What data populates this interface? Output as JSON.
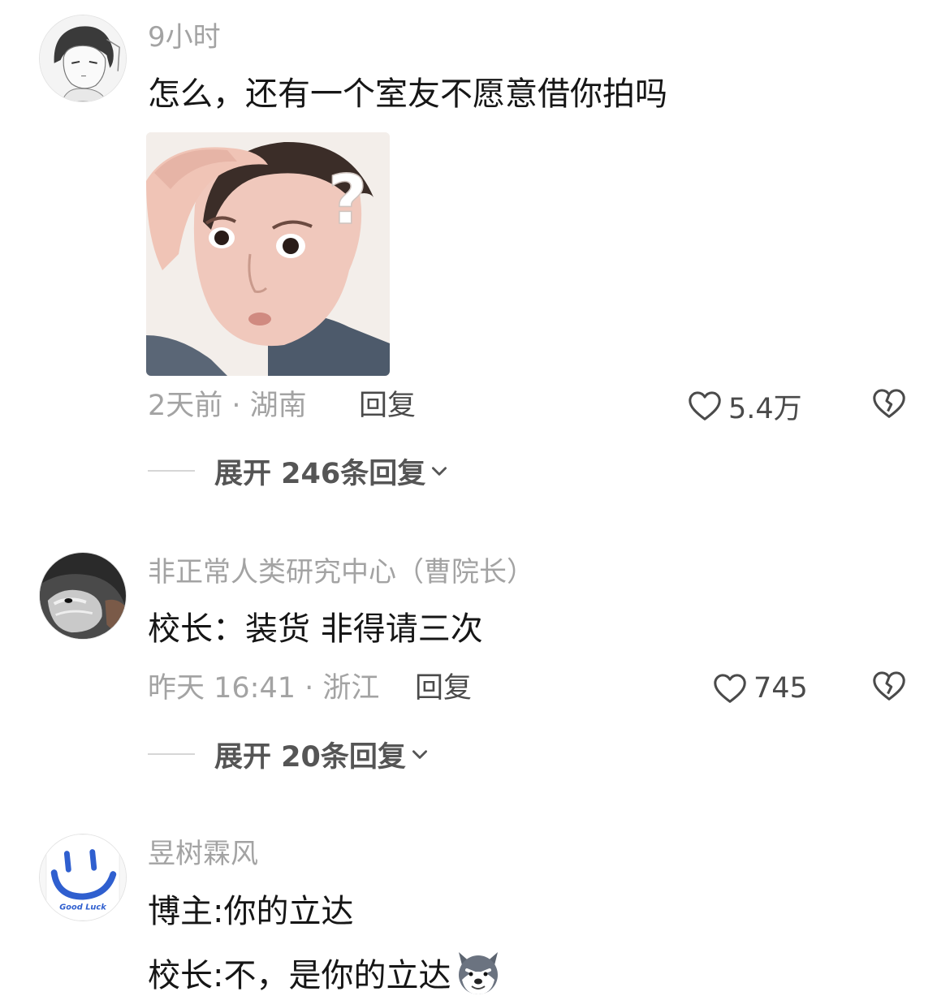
{
  "comments": [
    {
      "username": "9小时",
      "text": "怎么，还有一个室友不愿意借你拍吗",
      "image_desc": "meme-photo-question",
      "image_overlay": "?",
      "time": "2天前 · 湖南",
      "reply_label": "回复",
      "likes": "5.4万",
      "expand_label": "展开 246条回复"
    },
    {
      "username": "非正常人类研究中心（曹院长）",
      "text": "校长：装货 非得请三次",
      "time": "昨天 16:41 · 浙江",
      "reply_label": "回复",
      "likes": "745",
      "expand_label": "展开 20条回复"
    },
    {
      "username": "昱树霖风",
      "lines": [
        "博主:你的立达",
        "校长:不，是你的立达"
      ],
      "avatar_text": "Good Luck"
    }
  ],
  "icons": {
    "like": "heart-outline-icon",
    "dislike": "broken-heart-icon",
    "expand": "chevron-down-icon",
    "emoji": "husky-emoji-icon"
  },
  "colors": {
    "text_primary": "#161616",
    "text_secondary": "#a3a3a3",
    "action": "#4a4a4a",
    "expand": "#555555"
  }
}
